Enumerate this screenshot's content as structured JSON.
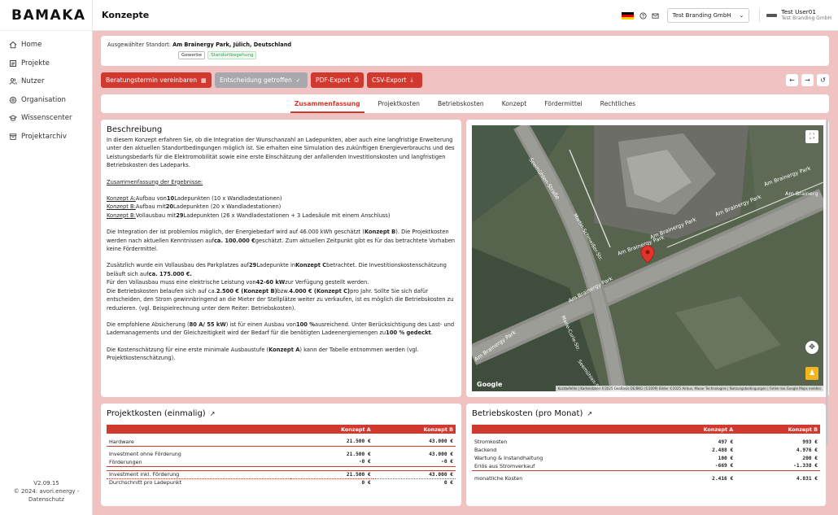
{
  "app": {
    "logo": "BAMAKA",
    "page_title": "Konzepte"
  },
  "sidebar": {
    "items": [
      {
        "label": "Home",
        "icon": "home-icon"
      },
      {
        "label": "Projekte",
        "icon": "projects-icon"
      },
      {
        "label": "Nutzer",
        "icon": "users-icon"
      },
      {
        "label": "Organisation",
        "icon": "organisation-icon"
      },
      {
        "label": "Wissenscenter",
        "icon": "graduation-icon"
      },
      {
        "label": "Projektarchiv",
        "icon": "archive-icon"
      }
    ],
    "version": "V2.09.15",
    "copyright": "© 2024: avori.energy -",
    "privacy": "Datenschutz"
  },
  "header": {
    "organisation": "Test Branding GmbH",
    "user_name": "Test User01",
    "user_org": "Test Branding GmbH",
    "flag_colors": [
      "#000000",
      "#dd0000",
      "#ffce00"
    ]
  },
  "location": {
    "label": "Ausgewählter Standort:",
    "value": "Am Brainergy Park, Jülich, Deutschland",
    "tags": [
      "Gewerbe",
      "Standortbegehung"
    ]
  },
  "actions": {
    "appointment": "Beratungstermin vereinbaren",
    "decision": "Entscheidung getroffen",
    "pdf": "PDF-Export",
    "csv": "CSV-Export"
  },
  "tabs": [
    "Zusammenfassung",
    "Projektkosten",
    "Betriebskosten",
    "Konzept",
    "Fördermittel",
    "Rechtliches"
  ],
  "description": {
    "title": "Beschreibung",
    "intro": "In diesem Konzept erfahren Sie, ob die Integration der Wunschanzahl an Ladepunkten, aber auch eine langfristige Erweiterung unter den aktuellen Standortbedingungen möglich ist. Sie erhalten eine Simulation des zukünftigen Energieverbrauchs und des Leistungsbedarfs für die Elektromobilität sowie eine erste Einschätzung der anfallenden Investitionskosten und langfristigen Betriebskosten des Ladeparks.",
    "summary_heading": "Zusammenfassung der Ergebnisse:",
    "concept_a_label": "Konzept A:",
    "concept_a_pre": "Aufbau von",
    "concept_a_num": "10",
    "concept_a_post": "Ladepunkten (10 x Wandladestationen)",
    "concept_b_label": "Konzept B:",
    "concept_b_pre": "Aufbau mit",
    "concept_b_num": "20",
    "concept_b_post": "Ladepunkten (20 x Wandladestationen)",
    "concept_c_label": "Konzept B:",
    "concept_c_pre": "Vollausbau mit",
    "concept_c_num": "29",
    "concept_c_post": "Ladepunkten (26 x Wandladestationen + 3 Ladesäule mit einem Anschluss)",
    "p2_a": "Die Integration der ist problemlos möglich, der Energiebedarf wird auf 46.000 kWh geschätzt (",
    "p2_b": "Konzept B",
    "p2_c": "). Die Projektkosten werden nach aktuellen Kenntnissen auf",
    "p2_d": "ca. 100.000 €",
    "p2_e": "geschätzt. Zum aktuellen Zeitpunkt gibt es für das betrachtete Vorhaben keine Fördermittel.",
    "p3_a": "Zusätzlich wurde ein Vollausbau des Parkplatzes auf",
    "p3_b": "29",
    "p3_c": "Ladepunkte in",
    "p3_d": "Konzept C",
    "p3_e": "betrachtet. Die Investitionskostenschätzung beläuft sich auf",
    "p3_f": "ca. 175.000 €.",
    "p3_g": "Für den Vollausbau muss eine elektrische Leistung von",
    "p3_h": "42-60 kW",
    "p3_i": "zur Verfügung gestellt werden.",
    "p3_j": "Die Betriebskosten belaufen sich auf ca.",
    "p3_k": "2.500 € (Konzept B)",
    "p3_l": "bzw.",
    "p3_m": "4.000 € (Konzept C)",
    "p3_n": "pro Jahr. Sollte Sie sich dafür entscheiden, den Strom gewinnbringend an die Mieter der Stellplätze weiter zu verkaufen, ist es möglich die Betriebskosten zu reduzieren. (vgl. Beispielrechnung unter dem Reiter: Betriebskosten).",
    "p4_a": "Die empfohlene Absicherung (",
    "p4_b": "80 A/ 55 kW",
    "p4_c": ") ist für einen Ausbau von",
    "p4_d": "100 %",
    "p4_e": "ausreichend. Unter Berücksichtigung des Last- und Lademanagements und der Gleichzeitigkeit wird der Bedarf für die benötigten Ladeenergiemengen zu",
    "p4_f": "100 % gedeckt",
    "p4_g": ".",
    "p5_a": "Die Kostenschätzung für eine erste minimale Ausbaustufe (",
    "p5_b": "Konzept A",
    "p5_c": ") kann der Tabelle entnommen werden (vgl. Projektkostenschätzung)."
  },
  "map": {
    "labels": [
      "Seemühlen-Straße",
      "Am Brainergy Park",
      "Am Brainergy Park",
      "Am Brainergy Park",
      "Am Brainergy Park",
      "Am Brainerg",
      "Martin-Schmeißer-Str.",
      "Marie-Curie-Str.",
      "Am Brainergy Park",
      "Am Brainergy Park",
      "Seemühlen-Straße"
    ],
    "google": "Google",
    "attribution": "Kurzbefehle | Kartendaten ©2025 GeoBasis-DE/BKG (©2009) Bilder ©2025 Airbus, Maxar Technologies | Nutzungsbedingungen | Fehler bei Google Maps melden"
  },
  "projektkosten": {
    "title": "Projektkosten (einmalig)",
    "headers": [
      "",
      "Konzept A",
      "Konzept B"
    ],
    "rows": [
      [
        "Hardware",
        "21.500 €",
        "43.000 €"
      ],
      [
        "Investment ohne Förderung",
        "21.500 €",
        "43.000 €"
      ],
      [
        "Förderungen",
        "-0 €",
        "-0 €"
      ],
      [
        "Investment inkl. Förderung",
        "21.500 €",
        "43.000 €"
      ],
      [
        "Durchschnitt pro Ladepunkt",
        "0 €",
        "0 €"
      ]
    ]
  },
  "betriebskosten": {
    "title": "Betriebskosten (pro Monat)",
    "headers": [
      "",
      "Konzept A",
      "Konzept B"
    ],
    "rows": [
      [
        "Stromkosten",
        "497 €",
        "993 €"
      ],
      [
        "Backend",
        "2.488 €",
        "4.976 €"
      ],
      [
        "Wartung & Instandhaltung",
        "100 €",
        "200 €"
      ],
      [
        "Erlös aus Stromverkauf",
        "-669 €",
        "-1.338 €"
      ],
      [
        "monatliche Kosten",
        "2.416 €",
        "4.831 €"
      ]
    ]
  },
  "colors": {
    "accent": "#d2392e",
    "background": "#f0c2c2",
    "grey_button": "#a9a9ad"
  }
}
